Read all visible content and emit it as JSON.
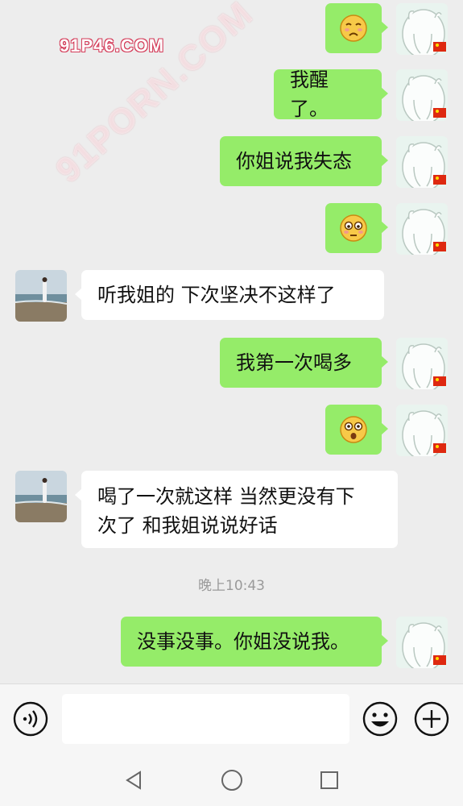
{
  "watermark": {
    "corner": "91P46.COM",
    "diagonal": "91PORN.COM"
  },
  "messages": [
    {
      "from": "me",
      "type": "emoji",
      "emoji": "sigh-face-icon"
    },
    {
      "from": "me",
      "type": "text",
      "text": "我醒了。"
    },
    {
      "from": "me",
      "type": "text",
      "text": "你姐说我失态"
    },
    {
      "from": "me",
      "type": "emoji",
      "emoji": "flushed-face-icon"
    },
    {
      "from": "other",
      "type": "text",
      "text": "听我姐的 下次坚决不这样了"
    },
    {
      "from": "me",
      "type": "text",
      "text": "我第一次喝多"
    },
    {
      "from": "me",
      "type": "emoji",
      "emoji": "surprised-face-icon"
    },
    {
      "from": "other",
      "type": "text",
      "lines": [
        "喝了一次就这样 当然更没有下",
        "次了 和我姐说说好话"
      ]
    },
    {
      "from": "me",
      "type": "text",
      "text": "没事没事。你姐没说我。"
    }
  ],
  "timestamp": "晚上10:43",
  "input": {
    "value": ""
  },
  "colors": {
    "my_bubble": "#95ec69",
    "their_bubble": "#ffffff",
    "background": "#ededed"
  },
  "icons": {
    "voice": "voice-icon",
    "emoji": "emoji-icon",
    "plus": "plus-icon"
  },
  "nav": {
    "back": "back-triangle-icon",
    "home": "home-circle-icon",
    "recents": "recents-square-icon"
  }
}
